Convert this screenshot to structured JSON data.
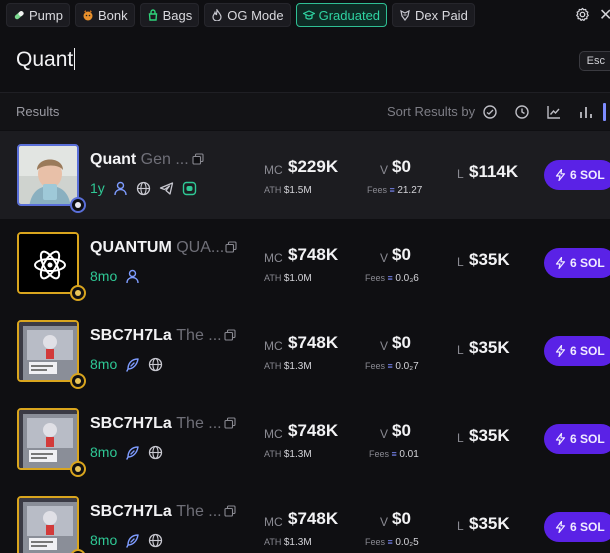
{
  "filters": [
    {
      "label": "Pump",
      "icon": "pill-icon"
    },
    {
      "label": "Bonk",
      "icon": "dog-icon"
    },
    {
      "label": "Bags",
      "icon": "bag-icon"
    },
    {
      "label": "OG Mode",
      "icon": "flame-icon"
    },
    {
      "label": "Graduated",
      "icon": "graduation-cap-icon",
      "active": true
    },
    {
      "label": "Dex Paid",
      "icon": "dex-icon"
    }
  ],
  "search": {
    "value": "Quant",
    "esc_label": "Esc"
  },
  "results": {
    "label": "Results",
    "sort_label": "Sort Results by"
  },
  "labels": {
    "mc": "MC",
    "v": "V",
    "l": "L",
    "ath": "ATH",
    "fees": "Fees",
    "fee_icon": "≡"
  },
  "tokens": [
    {
      "name": "Quant",
      "sub": "Gen ...",
      "age": "1y",
      "icons": [
        "person-icon",
        "globe-icon",
        "telegram-icon",
        "discord-icon"
      ],
      "mc": "$229K",
      "ath": "$1.5M",
      "v": "$0",
      "fees": "21.27",
      "l": "$114K",
      "buy": "6 SOL",
      "avatar": "photo",
      "border": "blue"
    },
    {
      "name": "QUANTUM",
      "sub": "QUA...",
      "age": "8mo",
      "icons": [
        "person-icon"
      ],
      "mc": "$748K",
      "ath": "$1.0M",
      "v": "$0",
      "fees": "0.0₃6",
      "l": "$35K",
      "buy": "6 SOL",
      "avatar": "atom",
      "border": "gold"
    },
    {
      "name": "SBC7H7La",
      "sub": "The ...",
      "age": "8mo",
      "icons": [
        "feather-icon",
        "globe-icon"
      ],
      "mc": "$748K",
      "ath": "$1.3M",
      "v": "$0",
      "fees": "0.0₂7",
      "l": "$35K",
      "buy": "6 SOL",
      "avatar": "pixel",
      "border": "gold"
    },
    {
      "name": "SBC7H7La",
      "sub": "The ...",
      "age": "8mo",
      "icons": [
        "feather-icon",
        "globe-icon"
      ],
      "mc": "$748K",
      "ath": "$1.3M",
      "v": "$0",
      "fees": "0.01",
      "l": "$35K",
      "buy": "6 SOL",
      "avatar": "pixel",
      "border": "gold"
    },
    {
      "name": "SBC7H7La",
      "sub": "The ...",
      "age": "8mo",
      "icons": [
        "feather-icon",
        "globe-icon"
      ],
      "mc": "$748K",
      "ath": "$1.3M",
      "v": "$0",
      "fees": "0.0₂5",
      "l": "$35K",
      "buy": "6 SOL",
      "avatar": "pixel",
      "border": "gold"
    }
  ],
  "colors": {
    "accent_green": "#2fc895",
    "buy_purple": "#5a22e6",
    "gold": "#d9a51e",
    "blue": "#5a6fd8"
  }
}
